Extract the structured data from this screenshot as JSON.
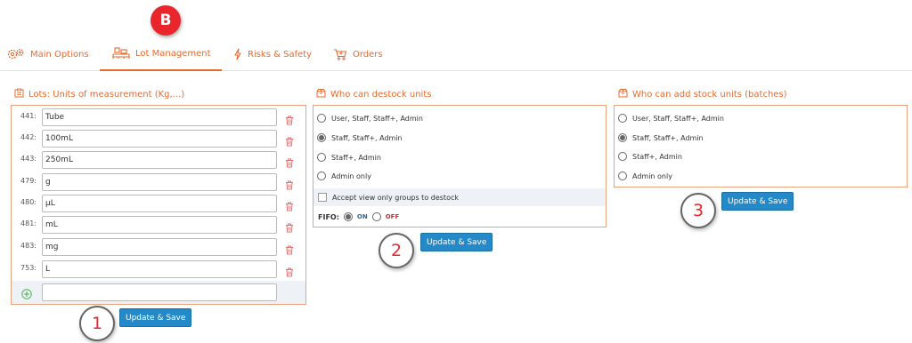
{
  "tabs": [
    {
      "label": "Main Options",
      "icon": "gears-icon"
    },
    {
      "label": "Lot Management",
      "icon": "pallet-icon",
      "active": true
    },
    {
      "label": "Risks & Safety",
      "icon": "lightning-icon"
    },
    {
      "label": "Orders",
      "icon": "cart-icon"
    }
  ],
  "callouts": {
    "tab_marker": "B",
    "step1": "1",
    "step2": "2",
    "step3": "3"
  },
  "units_panel": {
    "title": "Lots: Units of measurement (Kg,...)",
    "rows": [
      {
        "id": "441:",
        "value": "Tube"
      },
      {
        "id": "442:",
        "value": "100mL"
      },
      {
        "id": "443:",
        "value": "250mL"
      },
      {
        "id": "479:",
        "value": "g"
      },
      {
        "id": "480:",
        "value": "µL"
      },
      {
        "id": "481:",
        "value": "mL"
      },
      {
        "id": "483:",
        "value": "mg"
      },
      {
        "id": "753:",
        "value": "L"
      }
    ],
    "new_value": "",
    "save_label": "Update & Save"
  },
  "destock_panel": {
    "title": "Who can destock units",
    "options": [
      "User, Staff, Staff+, Admin",
      "Staff, Staff+, Admin",
      "Staff+, Admin",
      "Admin only"
    ],
    "selected": 1,
    "checkbox_label": "Accept view only groups to destock",
    "checkbox_checked": false,
    "fifo_label": "FIFO:",
    "fifo_on": "ON",
    "fifo_off": "OFF",
    "fifo_selected": "ON",
    "save_label": "Update & Save"
  },
  "stock_panel": {
    "title": "Who can add stock units (batches)",
    "options": [
      "User, Staff, Staff+, Admin",
      "Staff, Staff+, Admin",
      "Staff+, Admin",
      "Admin only"
    ],
    "selected": 1,
    "save_label": "Update & Save"
  },
  "colors": {
    "accent": "#e8692c",
    "button": "#2389c9",
    "marker": "#e8262b"
  }
}
